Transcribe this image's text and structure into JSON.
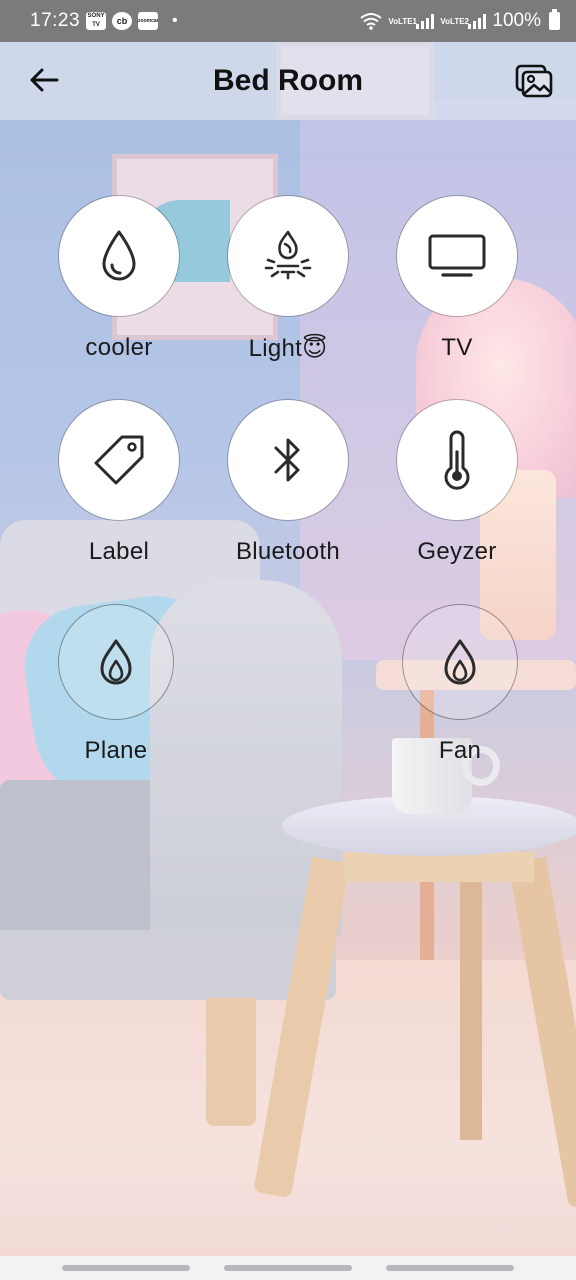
{
  "status_bar": {
    "time": "17:23",
    "app_icons": [
      "SONY TV",
      "cb",
      "zoomcar"
    ],
    "sim1": "VoLTE1",
    "sim2": "VoLTE2",
    "battery": "100%"
  },
  "app_bar": {
    "title": "Bed Room",
    "back_icon": "arrow-left-icon",
    "wallpaper_icon": "image-gallery-icon"
  },
  "devices": [
    {
      "label": "cooler",
      "icon": "water-drop-icon",
      "style": "solid"
    },
    {
      "label": "Light😇",
      "icon": "bonfire-icon",
      "style": "solid"
    },
    {
      "label": "TV",
      "icon": "tv-icon",
      "style": "solid"
    },
    {
      "label": "Label",
      "icon": "tag-icon",
      "style": "solid"
    },
    {
      "label": "Bluetooth",
      "icon": "bluetooth-icon",
      "style": "solid"
    },
    {
      "label": "Geyzer",
      "icon": "thermometer-icon",
      "style": "solid"
    },
    {
      "label": "Plane",
      "icon": "flame-icon",
      "style": "ghost"
    },
    {
      "label": "Fan",
      "icon": "flame-icon",
      "style": "ghost"
    }
  ],
  "colors": {
    "status_bar": "#7b7b7d",
    "app_bar": "#dce2ee",
    "icon_stroke": "#2b2b2b"
  }
}
